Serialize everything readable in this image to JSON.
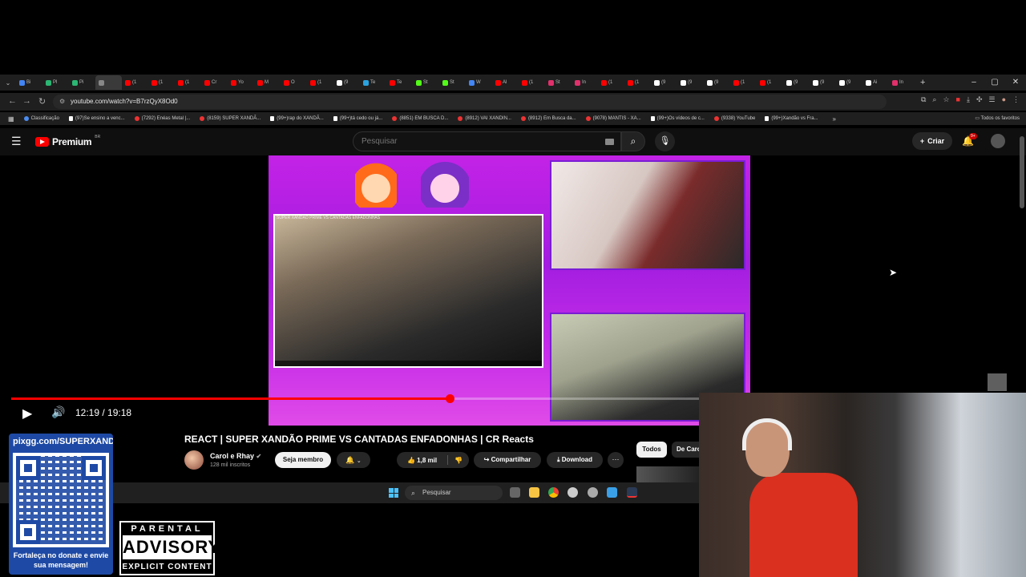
{
  "browser": {
    "tabs": [
      {
        "label": "Bi",
        "color": "#4285f4"
      },
      {
        "label": "Pl",
        "color": "#2bb673"
      },
      {
        "label": "Pi",
        "color": "#2bb673"
      },
      {
        "label": "",
        "color": "#888888",
        "active": true
      },
      {
        "label": "(1",
        "color": "#ff0000"
      },
      {
        "label": "(1",
        "color": "#ff0000"
      },
      {
        "label": "(1",
        "color": "#ff0000"
      },
      {
        "label": "Cr",
        "color": "#ff0000"
      },
      {
        "label": "Yo",
        "color": "#ff0000"
      },
      {
        "label": "M",
        "color": "#ff0000"
      },
      {
        "label": "O",
        "color": "#ff0000"
      },
      {
        "label": "(1",
        "color": "#ff0000"
      },
      {
        "label": "(9",
        "color": "#ffffff"
      },
      {
        "label": "Te",
        "color": "#2aa3e0"
      },
      {
        "label": "Te",
        "color": "#ff0000"
      },
      {
        "label": "St",
        "color": "#53fc18"
      },
      {
        "label": "St",
        "color": "#53fc18"
      },
      {
        "label": "W",
        "color": "#4285f4"
      },
      {
        "label": "Al",
        "color": "#ff0000"
      },
      {
        "label": "(1",
        "color": "#ff0000"
      },
      {
        "label": "St",
        "color": "#e1306c"
      },
      {
        "label": "In",
        "color": "#e1306c"
      },
      {
        "label": "(1",
        "color": "#ff0000"
      },
      {
        "label": "(1",
        "color": "#ff0000"
      },
      {
        "label": "(9",
        "color": "#ffffff"
      },
      {
        "label": "(9",
        "color": "#ffffff"
      },
      {
        "label": "(9",
        "color": "#ffffff"
      },
      {
        "label": "(1",
        "color": "#ff0000"
      },
      {
        "label": "(1",
        "color": "#ff0000"
      },
      {
        "label": "(9",
        "color": "#ffffff"
      },
      {
        "label": "(9",
        "color": "#ffffff"
      },
      {
        "label": "(9",
        "color": "#ffffff"
      },
      {
        "label": "Ai",
        "color": "#ffffff"
      },
      {
        "label": "In",
        "color": "#e1306c"
      }
    ],
    "url": "youtube.com/watch?v=B7rzQyX8Od0",
    "bookmarks": [
      {
        "label": "Classificação",
        "kind": "bl"
      },
      {
        "label": "(97)Se ensino a venc...",
        "kind": "tk"
      },
      {
        "label": "(7292) Enéas Metal |...",
        "kind": "yt"
      },
      {
        "label": "(8159) SUPER XANDÃ...",
        "kind": "yt"
      },
      {
        "label": "(99+)rap do XANDÃ...",
        "kind": "tk"
      },
      {
        "label": "(99+)tá cedo ou já...",
        "kind": "tk"
      },
      {
        "label": "(8851) EM BUSCA D...",
        "kind": "yt"
      },
      {
        "label": "(8912) VAI XANDIN...",
        "kind": "yt"
      },
      {
        "label": "(8912) Em Busca da...",
        "kind": "yt"
      },
      {
        "label": "(9078) MANTIS - XA...",
        "kind": "yt"
      },
      {
        "label": "(99+)Os vídeos de c...",
        "kind": "tk"
      },
      {
        "label": "(9338) YouTube",
        "kind": "yt"
      },
      {
        "label": "(99+)Xandão vs Fra...",
        "kind": "tk"
      }
    ],
    "all_favorites": "Todos os favoritos"
  },
  "yt": {
    "logo": "Premium",
    "region": "BR",
    "search_placeholder": "Pesquisar",
    "create_label": "Criar",
    "notif_badge": "9+"
  },
  "player": {
    "time": "12:19 / 19:18",
    "progress_fraction": 0.6375,
    "clip_title": "SUPER XANDÃO PRIME VS CANTADAS ENFADONHAS"
  },
  "video": {
    "title": "REACT | SUPER XANDÃO PRIME VS CANTADAS ENFADONHAS | CR Reacts",
    "channel": "Carol e Rhay",
    "subscribers": "128 mil inscritos",
    "join_label": "Seja membro",
    "likes": "1,8 mil",
    "share_label": "Compartilhar",
    "download_label": "Download",
    "chips": [
      "Todos",
      "De Carol"
    ]
  },
  "taskbar": {
    "search_label": "Pesquisar"
  },
  "overlay": {
    "qr_url": "pixgg.com/SUPERXANDAO",
    "qr_caption": "Fortaleça no donate e envie sua mensagem!",
    "advisory_top": "PARENTAL",
    "advisory_mid": "ADVISORY",
    "advisory_bot": "EXPLICIT CONTENT"
  }
}
